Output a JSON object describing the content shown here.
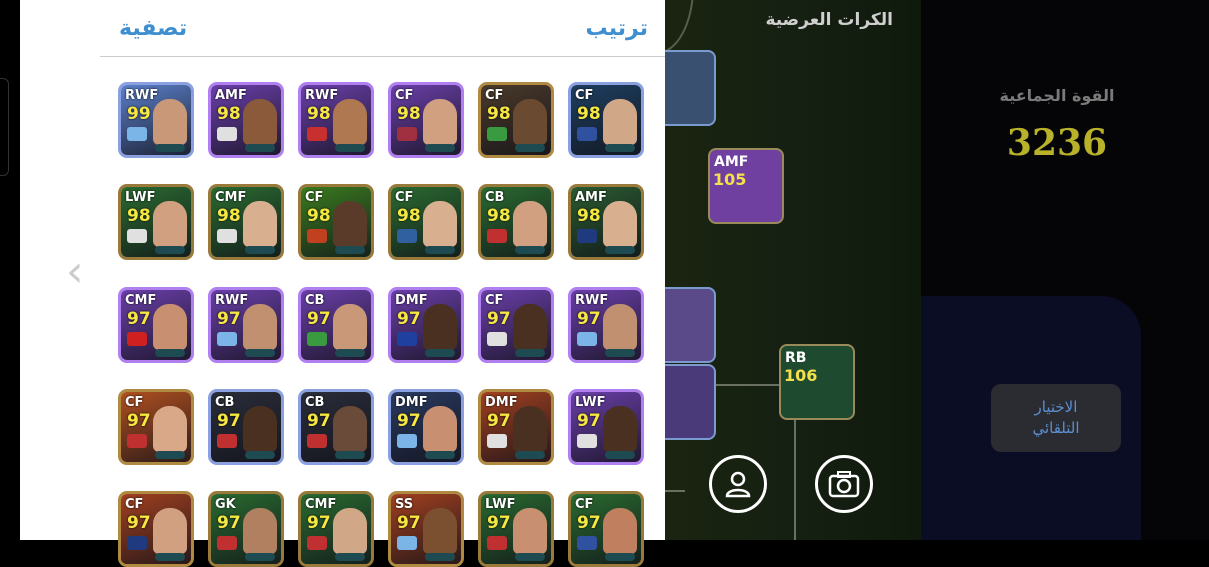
{
  "panel": {
    "sort_label": "ترتيب",
    "filter_label": "تصفية",
    "cards": [
      {
        "pos": "RWF",
        "rating": "99",
        "bg": "#5b7fc8",
        "face": "#c99878",
        "badge": "#7bb5e8"
      },
      {
        "pos": "AMF",
        "rating": "98",
        "bg": "#6a3fa8",
        "face": "#8a5a3a",
        "badge": "#e0e0e0"
      },
      {
        "pos": "RWF",
        "rating": "98",
        "bg": "#6a3fa8",
        "face": "#b07850",
        "badge": "#c83030"
      },
      {
        "pos": "CF",
        "rating": "98",
        "bg": "#6a3fa8",
        "face": "#d0a080",
        "badge": "#a03040"
      },
      {
        "pos": "CF",
        "rating": "98",
        "bg": "#4a3a2a",
        "face": "#6a4a30",
        "badge": "#3a9a40"
      },
      {
        "pos": "CF",
        "rating": "98",
        "bg": "#1e3f60",
        "face": "#d0a888",
        "badge": "#3050a0"
      },
      {
        "pos": "LWF",
        "rating": "98",
        "bg": "#2a6a30",
        "face": "#d0a080",
        "badge": "#e0e0e0"
      },
      {
        "pos": "CMF",
        "rating": "98",
        "bg": "#2a6a30",
        "face": "#d8b090",
        "badge": "#e0e0e0"
      },
      {
        "pos": "CF",
        "rating": "98",
        "bg": "#3a7a20",
        "face": "#5a3a28",
        "badge": "#c04020"
      },
      {
        "pos": "CF",
        "rating": "98",
        "bg": "#2a6a30",
        "face": "#d8b090",
        "badge": "#3060a0"
      },
      {
        "pos": "CB",
        "rating": "98",
        "bg": "#2a6a30",
        "face": "#d0a080",
        "badge": "#c03030"
      },
      {
        "pos": "AMF",
        "rating": "98",
        "bg": "#2a5a30",
        "face": "#d8b090",
        "badge": "#203a80"
      },
      {
        "pos": "CMF",
        "rating": "97",
        "bg": "#6a3fa8",
        "face": "#c89070",
        "badge": "#d02020"
      },
      {
        "pos": "RWF",
        "rating": "97",
        "bg": "#6a3fa8",
        "face": "#c09070",
        "badge": "#7bb5e8"
      },
      {
        "pos": "CB",
        "rating": "97",
        "bg": "#6a3fa8",
        "face": "#c89878",
        "badge": "#3a9a40"
      },
      {
        "pos": "DMF",
        "rating": "97",
        "bg": "#6a3fa8",
        "face": "#4a3020",
        "badge": "#2040a0"
      },
      {
        "pos": "CF",
        "rating": "97",
        "bg": "#6a3fa8",
        "face": "#4a3020",
        "badge": "#e0e0e0"
      },
      {
        "pos": "RWF",
        "rating": "97",
        "bg": "#6a3fa8",
        "face": "#c09070",
        "badge": "#7bb5e8"
      },
      {
        "pos": "CF",
        "rating": "97",
        "bg": "#b05020",
        "face": "#d8a888",
        "badge": "#c03030"
      },
      {
        "pos": "CB",
        "rating": "97",
        "bg": "#2a2e3a",
        "face": "#4a3020",
        "badge": "#c03030"
      },
      {
        "pos": "CB",
        "rating": "97",
        "bg": "#2a2e3a",
        "face": "#6a4a38",
        "badge": "#c03030"
      },
      {
        "pos": "DMF",
        "rating": "97",
        "bg": "#2a3a60",
        "face": "#c89070",
        "badge": "#7bb5e8"
      },
      {
        "pos": "DMF",
        "rating": "97",
        "bg": "#a04020",
        "face": "#4a3020",
        "badge": "#e0e0e0"
      },
      {
        "pos": "LWF",
        "rating": "97",
        "bg": "#6a3fa8",
        "face": "#4a3020",
        "badge": "#e0e0e0"
      },
      {
        "pos": "CF",
        "rating": "97",
        "bg": "#a04020",
        "face": "#d0a080",
        "badge": "#203a80"
      },
      {
        "pos": "GK",
        "rating": "97",
        "bg": "#2a6a30",
        "face": "#b08060",
        "badge": "#c03030"
      },
      {
        "pos": "CMF",
        "rating": "97",
        "bg": "#2a6a30",
        "face": "#d0a888",
        "badge": "#c03030"
      },
      {
        "pos": "SS",
        "rating": "97",
        "bg": "#a04020",
        "face": "#7a5030",
        "badge": "#7bb5e8"
      },
      {
        "pos": "LWF",
        "rating": "97",
        "bg": "#2a6a30",
        "face": "#c89070",
        "badge": "#c03030"
      },
      {
        "pos": "CF",
        "rating": "97",
        "bg": "#2a6a30",
        "face": "#c08060",
        "badge": "#3050a0"
      }
    ]
  },
  "pitch": {
    "section_title": "الكرات العرضية",
    "cards": [
      {
        "pos": "AMF",
        "rating": "105",
        "bg": "#7040a0",
        "face": "#c89878"
      },
      {
        "pos": "RB",
        "rating": "106",
        "bg": "#1e4a30",
        "face": "#d0a888"
      }
    ]
  },
  "team_power": {
    "label": "القوة الجماعية",
    "value": "3236"
  },
  "auto_select": {
    "line1": "الاختيار",
    "line2": "التلقائي"
  },
  "colors": {
    "accent_blue": "#3f8fd0",
    "rating_yellow": "#f6e742",
    "power_gold": "#b8b22a"
  }
}
